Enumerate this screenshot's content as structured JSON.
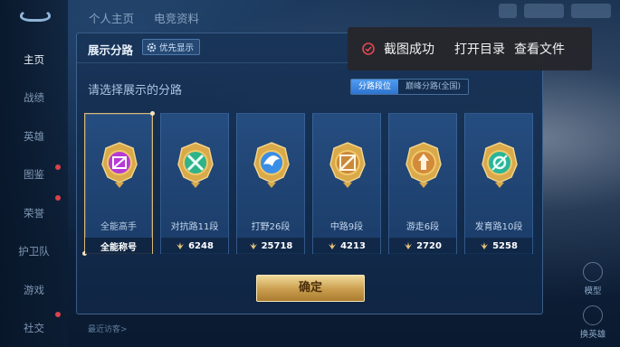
{
  "sidebar": {
    "items": [
      {
        "label": "主页",
        "active": true
      },
      {
        "label": "战绩"
      },
      {
        "label": "英雄"
      },
      {
        "label": "图鉴",
        "badge": true
      },
      {
        "label": "荣誉",
        "badge": true
      },
      {
        "label": "护卫队"
      },
      {
        "label": "游戏"
      },
      {
        "label": "社交",
        "badge": true
      }
    ]
  },
  "top_tabs": [
    "个人主页",
    "电竞资料"
  ],
  "panel": {
    "title": "展示分路",
    "priority_label": "优先显示",
    "subtitle": "请选择展示的分路",
    "segment": {
      "active": "分路段位",
      "inactive": "巅峰分路(全国)"
    },
    "cards": [
      {
        "name": "全能高手",
        "stat": "全能称号",
        "emblem": "all-round-emblem",
        "color": "#b63bd6",
        "selected": true
      },
      {
        "name": "对抗路11段",
        "stat": "6248",
        "emblem": "clash-lane-emblem",
        "color": "#2fb38a"
      },
      {
        "name": "打野26段",
        "stat": "25718",
        "emblem": "jungle-emblem",
        "color": "#3a8ee6"
      },
      {
        "name": "中路9段",
        "stat": "4213",
        "emblem": "mid-lane-emblem",
        "color": "#c9893b"
      },
      {
        "name": "游走6段",
        "stat": "2720",
        "emblem": "roam-emblem",
        "color": "#d38a3a"
      },
      {
        "name": "发育路10段",
        "stat": "5258",
        "emblem": "farm-lane-emblem",
        "color": "#2ab59a"
      }
    ],
    "confirm_label": "确定",
    "recent_label": "最近访客>"
  },
  "toast": {
    "message": "截图成功",
    "action_open": "打开目录",
    "action_view": "查看文件",
    "accent": "#e2494f"
  },
  "right_buttons": [
    "模型",
    "换英雄"
  ]
}
